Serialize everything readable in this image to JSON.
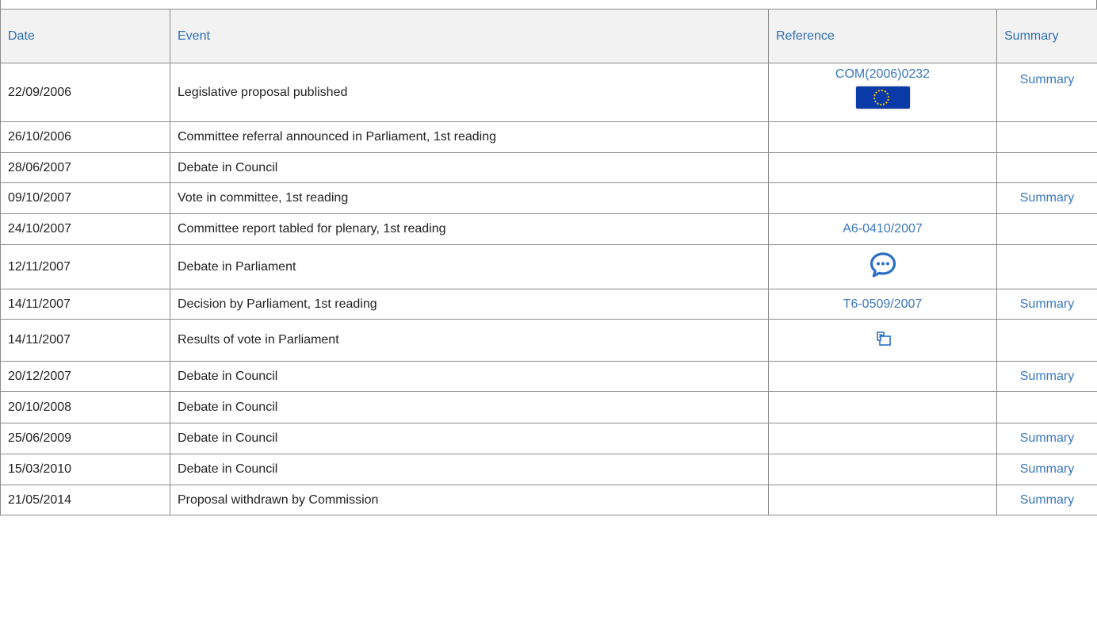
{
  "table": {
    "headers": {
      "date": "Date",
      "event": "Event",
      "reference": "Reference",
      "summary": "Summary"
    },
    "rows": [
      {
        "date": "22/09/2006",
        "event": "Legislative proposal published",
        "reference": "COM(2006)0232",
        "reference_icon": "eu-flag-icon",
        "summary": "Summary"
      },
      {
        "date": "26/10/2006",
        "event": "Committee referral announced in Parliament, 1st reading",
        "reference": "",
        "summary": ""
      },
      {
        "date": "28/06/2007",
        "event": "Debate in Council",
        "reference": "",
        "summary": ""
      },
      {
        "date": "09/10/2007",
        "event": "Vote in committee, 1st reading",
        "reference": "",
        "summary": "Summary"
      },
      {
        "date": "24/10/2007",
        "event": "Committee report tabled for plenary, 1st reading",
        "reference": "A6-0410/2007",
        "summary": ""
      },
      {
        "date": "12/11/2007",
        "event": "Debate in Parliament",
        "reference": "",
        "reference_icon": "debate-speech-bubble-icon",
        "summary": ""
      },
      {
        "date": "14/11/2007",
        "event": "Decision by Parliament, 1st reading",
        "reference": "T6-0509/2007",
        "summary": "Summary"
      },
      {
        "date": "14/11/2007",
        "event": "Results of vote in Parliament",
        "reference": "",
        "reference_icon": "vote-results-icon",
        "summary": ""
      },
      {
        "date": "20/12/2007",
        "event": "Debate in Council",
        "reference": "",
        "summary": "Summary"
      },
      {
        "date": "20/10/2008",
        "event": "Debate in Council",
        "reference": "",
        "summary": ""
      },
      {
        "date": "25/06/2009",
        "event": "Debate in Council",
        "reference": "",
        "summary": "Summary"
      },
      {
        "date": "15/03/2010",
        "event": "Debate in Council",
        "reference": "",
        "summary": "Summary"
      },
      {
        "date": "21/05/2014",
        "event": "Proposal withdrawn by Commission",
        "reference": "",
        "summary": "Summary"
      }
    ]
  },
  "colors": {
    "link": "#3b78bf",
    "header_bg": "#f2f2f2",
    "border": "#8c8c8c",
    "flag_blue": "#0a3aa5",
    "flag_gold": "#f2c200"
  }
}
